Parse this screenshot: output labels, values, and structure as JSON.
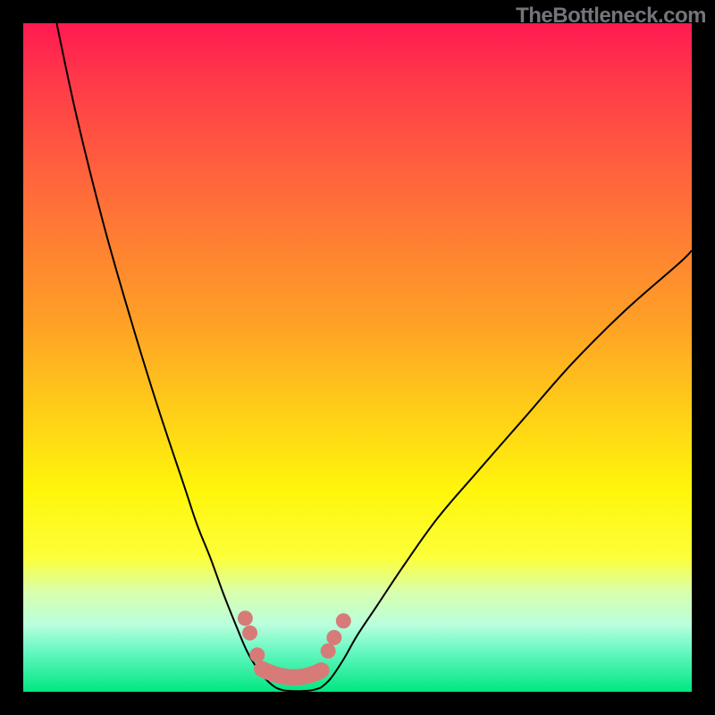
{
  "watermark": "TheBottleneck.com",
  "colors": {
    "frame": "#000000",
    "gradient_top": "#ff1a51",
    "gradient_mid": "#ffd516",
    "gradient_bottom": "#00e780",
    "curve": "#000000",
    "marker": "#d77b78"
  },
  "chart_data": {
    "type": "line",
    "title": "",
    "xlabel": "",
    "ylabel": "",
    "xlim": [
      0,
      100
    ],
    "ylim": [
      0,
      100
    ],
    "series": [
      {
        "name": "left-curve",
        "x": [
          5,
          8,
          12,
          16,
          20,
          24,
          26,
          28,
          30,
          32,
          33.5,
          35,
          36,
          37,
          37.8
        ],
        "y": [
          100,
          86,
          70,
          56,
          43,
          31,
          25,
          20,
          14.5,
          9.5,
          6,
          3.5,
          2.2,
          1.2,
          0.6
        ]
      },
      {
        "name": "right-curve",
        "x": [
          44.5,
          46,
          48,
          50,
          53,
          57,
          62,
          68,
          75,
          82,
          90,
          98,
          100
        ],
        "y": [
          0.6,
          2,
          5,
          8.5,
          13,
          19,
          26,
          33,
          41,
          49,
          57,
          64,
          66
        ]
      },
      {
        "name": "valley-floor",
        "x": [
          37.8,
          39,
          41,
          43,
          44.5
        ],
        "y": [
          0.6,
          0.2,
          0.1,
          0.2,
          0.6
        ]
      }
    ],
    "markers": {
      "name": "highlight-dots",
      "points": [
        {
          "x": 33.2,
          "y": 11.0
        },
        {
          "x": 33.9,
          "y": 8.8
        },
        {
          "x": 35.0,
          "y": 5.5
        },
        {
          "x": 45.6,
          "y": 6.1
        },
        {
          "x": 46.5,
          "y": 8.1
        },
        {
          "x": 47.9,
          "y": 10.6
        }
      ],
      "bar": {
        "x_start": 35.7,
        "y_start": 3.4,
        "x_mid": 40.5,
        "y_mid": 1.0,
        "x_end": 44.6,
        "y_end": 3.2
      }
    }
  }
}
